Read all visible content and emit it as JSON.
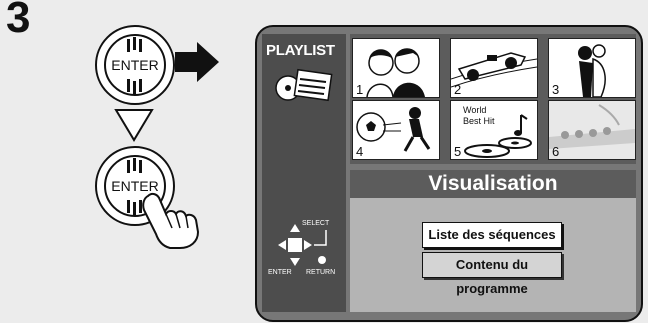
{
  "step": {
    "number": "3"
  },
  "buttons": {
    "enter_top": "ENTER",
    "enter_bottom": "ENTER"
  },
  "screen": {
    "sidebar_title": "PLAYLIST",
    "thumbnails": [
      {
        "num": "1",
        "caption": ""
      },
      {
        "num": "2",
        "caption": ""
      },
      {
        "num": "3",
        "caption": ""
      },
      {
        "num": "4",
        "caption": ""
      },
      {
        "num": "5",
        "caption_line1": "World",
        "caption_line2": "Best Hit"
      },
      {
        "num": "6",
        "caption": ""
      }
    ],
    "menu": {
      "title": "Visualisation",
      "options": [
        "Liste des séquences",
        "Contenu du programme"
      ]
    },
    "remote": {
      "select": "SELECT",
      "enter": "ENTER",
      "return": "RETURN"
    }
  },
  "colors": {
    "panel_bg": "#ececec",
    "sidebar": "#4d4d4d",
    "menu_bg": "#b4b4b4",
    "menu_header": "#5c5c5c"
  }
}
